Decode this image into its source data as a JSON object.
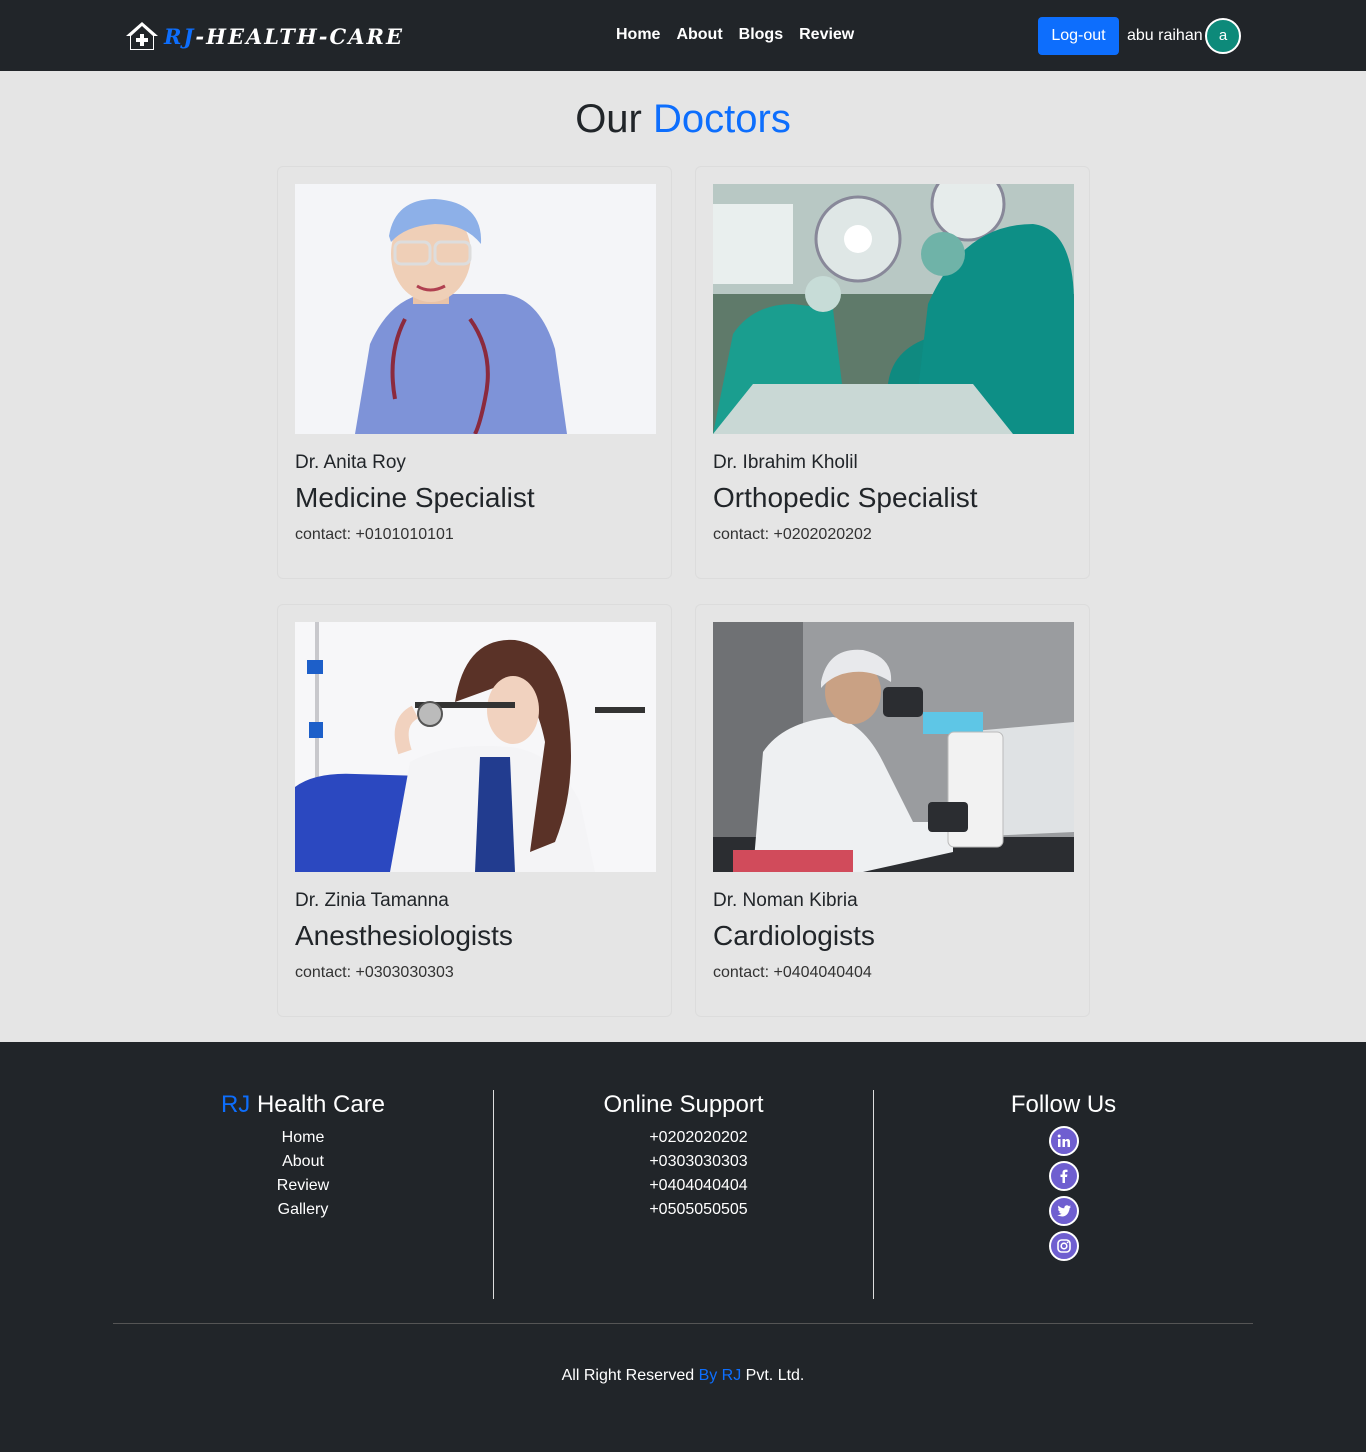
{
  "navbar": {
    "brand_rj": "RJ",
    "brand_rest": "-HEALTH-CARE",
    "links": [
      "Home",
      "About",
      "Blogs",
      "Review"
    ],
    "logout_label": "Log-out",
    "username": "abu raihan",
    "avatar_letter": "a",
    "avatar_color": "#0d8a7a"
  },
  "page": {
    "title_plain": "Our",
    "title_accent": "Doctors",
    "accent_color": "#0d6efd"
  },
  "doctors": [
    {
      "name": "Dr. Anita Roy",
      "specialty": "Medicine Specialist",
      "contact": "contact: +0101010101"
    },
    {
      "name": "Dr. Ibrahim Kholil",
      "specialty": "Orthopedic Specialist",
      "contact": "contact: +0202020202"
    },
    {
      "name": "Dr. Zinia Tamanna",
      "specialty": "Anesthesiologists",
      "contact": "contact: +0303030303"
    },
    {
      "name": "Dr. Noman Kibria",
      "specialty": "Cardiologists",
      "contact": "contact: +0404040404"
    }
  ],
  "footer": {
    "brand_accent": "RJ",
    "brand_rest": " Health Care",
    "links": [
      "Home",
      "About",
      "Review",
      "Gallery"
    ],
    "support_title": "Online Support",
    "phones": [
      "+0202020202",
      "+0303030303",
      "+0404040404",
      "+0505050505"
    ],
    "follow_title": "Follow Us",
    "social_icons": [
      "linkedin-icon",
      "facebook-icon",
      "twitter-icon",
      "instagram-icon"
    ],
    "copyright_pre": "All Right Reserved ",
    "copyright_accent": "By RJ",
    "copyright_post": " Pvt. Ltd."
  }
}
